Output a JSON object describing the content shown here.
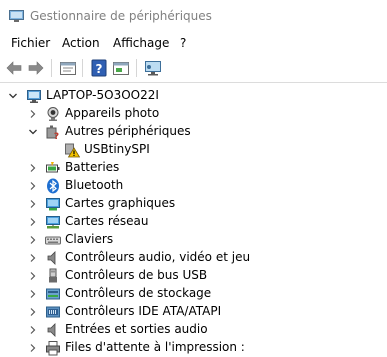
{
  "window": {
    "title": "Gestionnaire de périphériques"
  },
  "menu": [
    "Fichier",
    "Action",
    "Affichage",
    "?"
  ],
  "toolbar": [
    "back-icon",
    "forward-icon",
    "properties-icon",
    "help-icon",
    "update-driver-icon",
    "scan-hardware-icon"
  ],
  "tree": {
    "root": {
      "label": "LAPTOP-5O3OO22I",
      "icon": "computer-icon",
      "expanded": true
    },
    "items": [
      {
        "label": "Appareils photo",
        "icon": "camera-icon",
        "expanded": false
      },
      {
        "label": "Autres périphériques",
        "icon": "unknown-device-icon",
        "expanded": true,
        "children": [
          {
            "label": "USBtinySPI",
            "icon": "warning-icon"
          }
        ]
      },
      {
        "label": "Batteries",
        "icon": "battery-icon",
        "expanded": false
      },
      {
        "label": "Bluetooth",
        "icon": "bluetooth-icon",
        "expanded": false
      },
      {
        "label": "Cartes graphiques",
        "icon": "display-adapter-icon",
        "expanded": false
      },
      {
        "label": "Cartes réseau",
        "icon": "network-adapter-icon",
        "expanded": false
      },
      {
        "label": "Claviers",
        "icon": "keyboard-icon",
        "expanded": false
      },
      {
        "label": "Contrôleurs audio, vidéo et jeu",
        "icon": "speaker-icon",
        "expanded": false
      },
      {
        "label": "Contrôleurs de bus USB",
        "icon": "usb-icon",
        "expanded": false
      },
      {
        "label": "Contrôleurs de stockage",
        "icon": "storage-controller-icon",
        "expanded": false
      },
      {
        "label": "Contrôleurs IDE ATA/ATAPI",
        "icon": "ide-controller-icon",
        "expanded": false
      },
      {
        "label": "Entrées et sorties audio",
        "icon": "audio-io-icon",
        "expanded": false
      },
      {
        "label": "Files d'attente à l'impression :",
        "icon": "printer-icon",
        "expanded": false
      }
    ]
  }
}
